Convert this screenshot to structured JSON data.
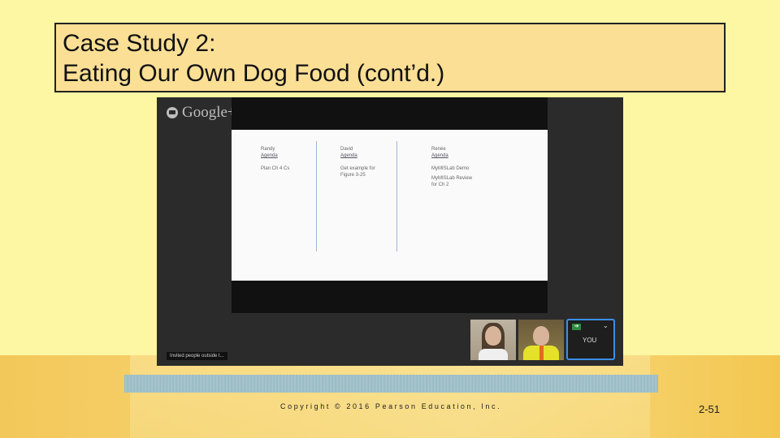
{
  "title": {
    "line1": "Case Study 2:",
    "line2": "Eating Our Own Dog Food (cont’d.)"
  },
  "hangout": {
    "logo_text": "Google+",
    "doc_columns": [
      {
        "name": "Randy",
        "link": "Agenda",
        "task": "Plan Ch 4 Cs"
      },
      {
        "name": "David",
        "link": "Agenda",
        "task": "Get example for Figure 3-25"
      },
      {
        "name": "Renée",
        "link": "Agenda",
        "task": "MyMISLab Demo",
        "task2": "MyMISLab Review for Ch 2"
      }
    ],
    "you_label": "YOU",
    "invited_text": "Invited people outside t..."
  },
  "footer": {
    "copyright": "Copyright © 2016 Pearson Education, Inc.",
    "page_number": "2-51"
  },
  "colors": {
    "background": "#fdf6a3",
    "title_fill": "#fbdf95",
    "active_tile_border": "#3b8ee8"
  },
  "icons": [
    "hangouts-icon",
    "share-screen-icon",
    "chevron-down-icon"
  ]
}
